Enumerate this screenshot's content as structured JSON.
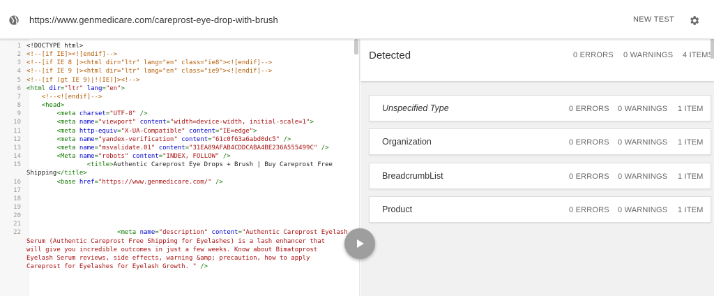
{
  "header": {
    "url": "https://www.genmedicare.com/careprost-eye-drop-with-brush",
    "new_test": "NEW TEST",
    "icons": {
      "globe": "globe-icon",
      "gear": "gear-icon"
    }
  },
  "code": {
    "lines": [
      {
        "n": "1",
        "parts": [
          [
            "txt",
            "<!DOCTYPE html>"
          ]
        ]
      },
      {
        "n": "2",
        "parts": [
          [
            "com",
            "<!--[if IE]><![endif]-->"
          ]
        ]
      },
      {
        "n": "3",
        "parts": [
          [
            "com",
            "<!--[if IE 8 ]><html dir=\"ltr\" lang=\"en\" class=\"ie8\"><![endif]-->"
          ]
        ]
      },
      {
        "n": "4",
        "parts": [
          [
            "com",
            "<!--[if IE 9 ]><html dir=\"ltr\" lang=\"en\" class=\"ie9\"><![endif]-->"
          ]
        ]
      },
      {
        "n": "5",
        "parts": [
          [
            "com",
            "<!--[if (gt IE 9)|!(IE)]><!-->"
          ]
        ]
      },
      {
        "n": "6",
        "parts": [
          [
            "tag",
            "<html "
          ],
          [
            "attr",
            "dir"
          ],
          [
            "tag",
            "="
          ],
          [
            "val",
            "\"ltr\""
          ],
          [
            "tag",
            " "
          ],
          [
            "attr",
            "lang"
          ],
          [
            "tag",
            "="
          ],
          [
            "val",
            "\"en\""
          ],
          [
            "tag",
            ">"
          ]
        ]
      },
      {
        "n": "7",
        "parts": [
          [
            "txt",
            "    "
          ],
          [
            "com",
            "<!--<![endif]-->"
          ]
        ]
      },
      {
        "n": "8",
        "parts": [
          [
            "txt",
            "    "
          ],
          [
            "tag",
            "<head>"
          ]
        ]
      },
      {
        "n": "9",
        "parts": [
          [
            "txt",
            "        "
          ],
          [
            "tag",
            "<meta "
          ],
          [
            "attr",
            "charset"
          ],
          [
            "tag",
            "="
          ],
          [
            "val",
            "\"UTF-8\""
          ],
          [
            "tag",
            " />"
          ]
        ]
      },
      {
        "n": "10",
        "parts": [
          [
            "txt",
            "        "
          ],
          [
            "tag",
            "<meta "
          ],
          [
            "attr",
            "name"
          ],
          [
            "tag",
            "="
          ],
          [
            "val",
            "\"viewport\""
          ],
          [
            "tag",
            " "
          ],
          [
            "attr",
            "content"
          ],
          [
            "tag",
            "="
          ],
          [
            "val",
            "\"width=device-width, initial-scale=1\""
          ],
          [
            "tag",
            ">"
          ]
        ]
      },
      {
        "n": "11",
        "parts": [
          [
            "txt",
            "        "
          ],
          [
            "tag",
            "<meta "
          ],
          [
            "attr",
            "http-equiv"
          ],
          [
            "tag",
            "="
          ],
          [
            "val",
            "\"X-UA-Compatible\""
          ],
          [
            "tag",
            " "
          ],
          [
            "attr",
            "content"
          ],
          [
            "tag",
            "="
          ],
          [
            "val",
            "\"IE=edge\""
          ],
          [
            "tag",
            ">"
          ]
        ]
      },
      {
        "n": "12",
        "parts": [
          [
            "txt",
            "        "
          ],
          [
            "tag",
            "<meta "
          ],
          [
            "attr",
            "name"
          ],
          [
            "tag",
            "="
          ],
          [
            "val",
            "\"yandex-verification\""
          ],
          [
            "tag",
            " "
          ],
          [
            "attr",
            "content"
          ],
          [
            "tag",
            "="
          ],
          [
            "val",
            "\"61c0f63a6abd0dc5\""
          ],
          [
            "tag",
            " />"
          ]
        ]
      },
      {
        "n": "13",
        "parts": [
          [
            "txt",
            "        "
          ],
          [
            "tag",
            "<meta "
          ],
          [
            "attr",
            "name"
          ],
          [
            "tag",
            "="
          ],
          [
            "val",
            "\"msvalidate.01\""
          ],
          [
            "tag",
            " "
          ],
          [
            "attr",
            "content"
          ],
          [
            "tag",
            "="
          ],
          [
            "val",
            "\"31EA89AFAB4CDDCABA4BE236A555499C\""
          ],
          [
            "tag",
            " />"
          ]
        ]
      },
      {
        "n": "14",
        "parts": [
          [
            "txt",
            "        "
          ],
          [
            "tag",
            "<Meta "
          ],
          [
            "attr",
            "name"
          ],
          [
            "tag",
            "="
          ],
          [
            "val",
            "\"robots\""
          ],
          [
            "tag",
            " "
          ],
          [
            "attr",
            "content"
          ],
          [
            "tag",
            "="
          ],
          [
            "val",
            "\"INDEX, FOLLOW\""
          ],
          [
            "tag",
            " />"
          ]
        ]
      },
      {
        "n": "15",
        "parts": [
          [
            "txt",
            "                "
          ],
          [
            "tag",
            "<title>"
          ],
          [
            "txt",
            "Authentic Careprost Eye Drops + Brush | Buy Careprost Free"
          ]
        ]
      },
      {
        "n": "",
        "parts": [
          [
            "txt",
            "Shipping"
          ],
          [
            "tag",
            "</title>"
          ]
        ]
      },
      {
        "n": "16",
        "parts": [
          [
            "txt",
            "        "
          ],
          [
            "tag",
            "<base "
          ],
          [
            "attr",
            "href"
          ],
          [
            "tag",
            "="
          ],
          [
            "val",
            "\"https://www.genmedicare.com/\""
          ],
          [
            "tag",
            " />"
          ]
        ]
      },
      {
        "n": "17",
        "parts": []
      },
      {
        "n": "18",
        "parts": []
      },
      {
        "n": "19",
        "parts": []
      },
      {
        "n": "20",
        "parts": []
      },
      {
        "n": "21",
        "parts": []
      },
      {
        "n": "22",
        "parts": [
          [
            "txt",
            "                        "
          ],
          [
            "tag",
            "<meta "
          ],
          [
            "attr",
            "name"
          ],
          [
            "tag",
            "="
          ],
          [
            "val",
            "\"description\""
          ],
          [
            "tag",
            " "
          ],
          [
            "attr",
            "content"
          ],
          [
            "tag",
            "="
          ],
          [
            "val",
            "\"Authentic Careprost Eyelash"
          ]
        ]
      },
      {
        "n": "",
        "parts": [
          [
            "val",
            "Serum (Authentic Careprost Free Shipping for Eyelashes) is a lash enhancer that"
          ]
        ]
      },
      {
        "n": "",
        "parts": [
          [
            "val",
            "will give you incredible outcomes in just a few weeks. Know about Bimatoprost"
          ]
        ]
      },
      {
        "n": "",
        "parts": [
          [
            "val",
            "Eyelash Serum reviews, side effects, warning &amp; precaution, how to apply"
          ]
        ]
      },
      {
        "n": "",
        "parts": [
          [
            "val",
            "Careprost for Eyelashes for Eyelash Growth. \""
          ],
          [
            "tag",
            " />"
          ]
        ]
      }
    ]
  },
  "play_button": {
    "icon": "play-icon"
  },
  "detected": {
    "title": "Detected",
    "errors": "0 ERRORS",
    "warnings": "0 WARNINGS",
    "items": "4 ITEMS"
  },
  "types": [
    {
      "name": "Unspecified Type",
      "italic": true,
      "errors": "0 ERRORS",
      "warnings": "0 WARNINGS",
      "items": "1 ITEM"
    },
    {
      "name": "Organization",
      "italic": false,
      "errors": "0 ERRORS",
      "warnings": "0 WARNINGS",
      "items": "1 ITEM"
    },
    {
      "name": "BreadcrumbList",
      "italic": false,
      "errors": "0 ERRORS",
      "warnings": "0 WARNINGS",
      "items": "1 ITEM"
    },
    {
      "name": "Product",
      "italic": false,
      "errors": "0 ERRORS",
      "warnings": "0 WARNINGS",
      "items": "1 ITEM"
    }
  ]
}
